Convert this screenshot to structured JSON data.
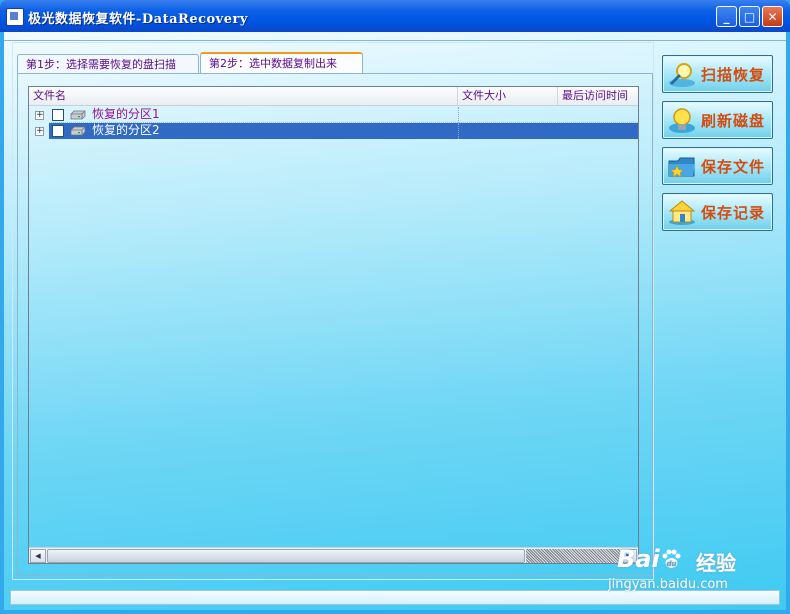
{
  "window": {
    "title": "极光数据恢复软件-DataRecovery",
    "controls": {
      "minimize": "_",
      "maximize": "□",
      "close": "✕"
    }
  },
  "tabs": [
    {
      "label": "第1步：选择需要恢复的盘扫描",
      "selected": false
    },
    {
      "label": "第2步：选中数据复制出来",
      "selected": true
    }
  ],
  "file_list": {
    "columns": [
      "文件名",
      "文件大小",
      "最后访问时间"
    ],
    "rows": [
      {
        "expander": "+",
        "name": "恢复的分区1",
        "checked": false,
        "selected": false,
        "icon": "disk-icon"
      },
      {
        "expander": "+",
        "name": "恢复的分区2",
        "checked": false,
        "selected": true,
        "icon": "disk-icon"
      }
    ],
    "scroll_left": "◀",
    "scroll_right": "▶"
  },
  "side_buttons": [
    {
      "label": "扫描恢复",
      "icon": "magnifier-scan-icon"
    },
    {
      "label": "刷新磁盘",
      "icon": "refresh-lightbulb-icon"
    },
    {
      "label": "保存文件",
      "icon": "save-file-folder-icon"
    },
    {
      "label": "保存记录",
      "icon": "save-record-house-icon"
    }
  ],
  "watermark": {
    "brand": "Bai",
    "brand2": "du",
    "jingyan": "经验",
    "url": "jingyan.baidu.com"
  },
  "colors": {
    "title_bar": "#0054e3",
    "selection": "#316ac5",
    "side_button_text": "#d34d13",
    "tab_text": "#5a0a8a",
    "row_text": "#9a108a"
  }
}
